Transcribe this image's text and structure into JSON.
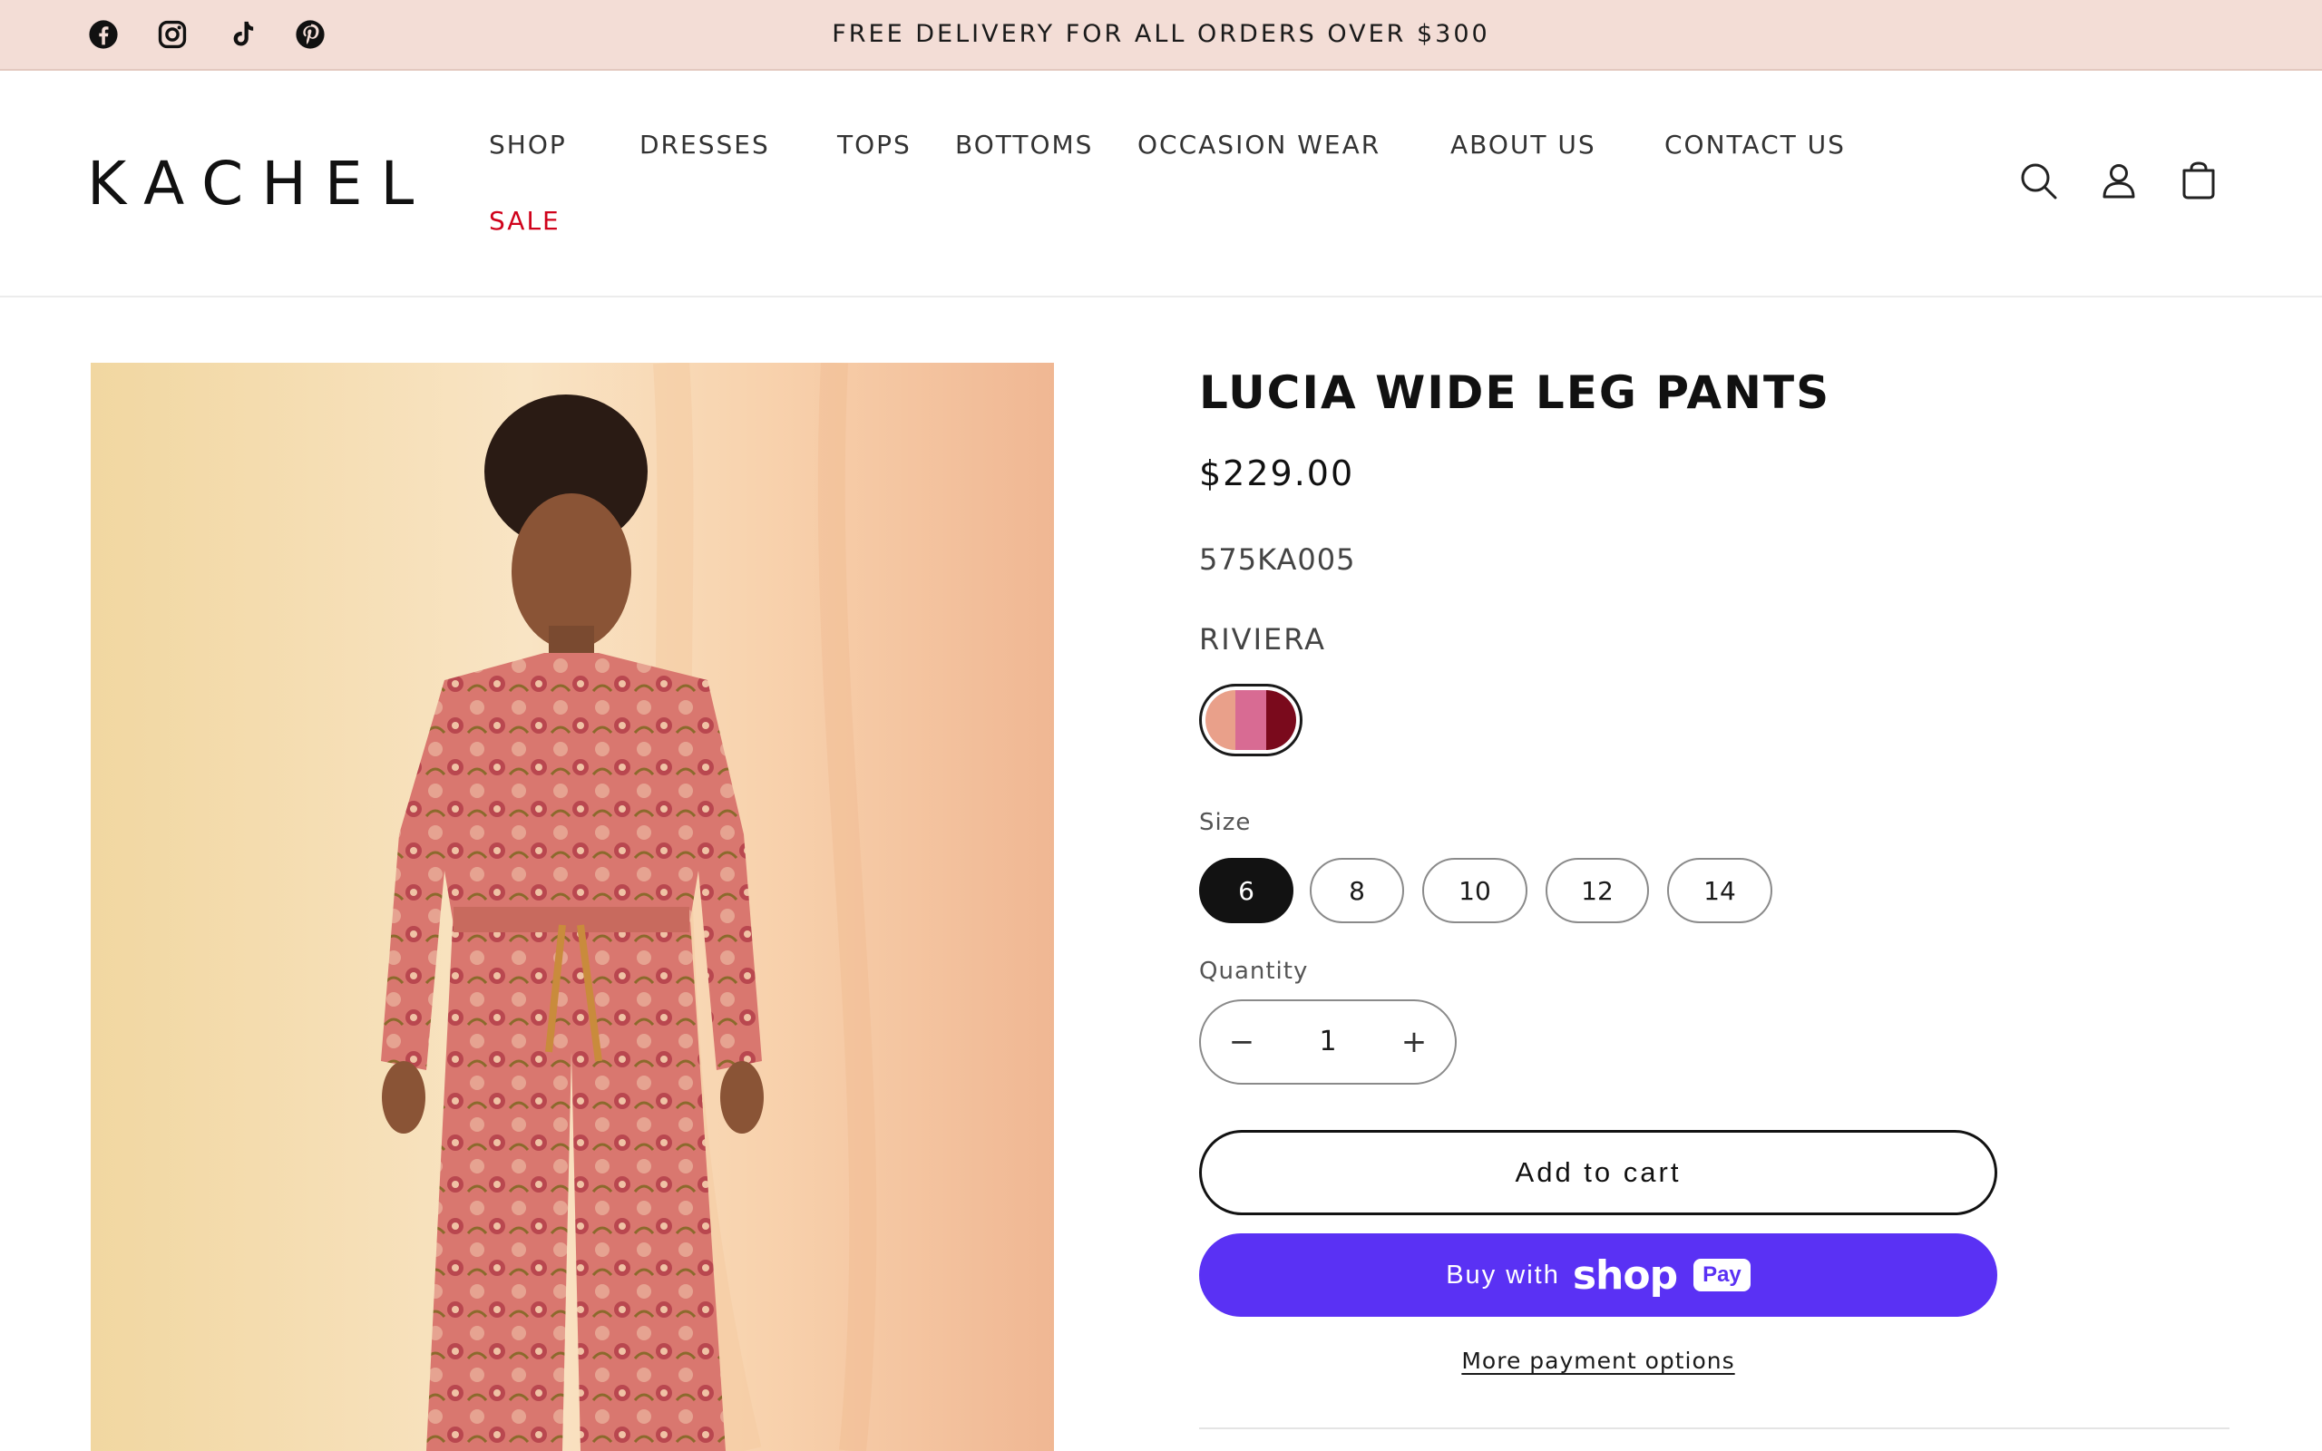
{
  "announcement": {
    "text": "FREE DELIVERY FOR ALL ORDERS OVER $300",
    "social": [
      "facebook-icon",
      "instagram-icon",
      "tiktok-icon",
      "pinterest-icon"
    ]
  },
  "header": {
    "logo": "KACHEL",
    "nav": {
      "shop": "SHOP",
      "dresses": "DRESSES",
      "tops": "TOPS",
      "bottoms": "BOTTOMS",
      "occasion": "OCCASION WEAR",
      "about": "ABOUT US",
      "contact": "CONTACT US",
      "sale": "SALE"
    },
    "icons": [
      "search-icon",
      "account-icon",
      "cart-icon"
    ],
    "sale_color": "#d0021b"
  },
  "product": {
    "title": "LUCIA WIDE LEG PANTS",
    "price": "$229.00",
    "sku": "575KA005",
    "color_name": "RIVIERA",
    "swatch_colors": [
      "#e9a08a",
      "#d86b93",
      "#7a0a1c"
    ],
    "size_label": "Size",
    "sizes": [
      "6",
      "8",
      "10",
      "12",
      "14"
    ],
    "selected_size": "6",
    "quantity_label": "Quantity",
    "quantity": "1",
    "minus": "−",
    "plus": "+",
    "add_to_cart": "Add to cart",
    "buy_with": "Buy with",
    "shop_word": "shop",
    "pay_badge": "Pay",
    "more_payment": "More payment options",
    "shoppay_color": "#5a31f4"
  }
}
